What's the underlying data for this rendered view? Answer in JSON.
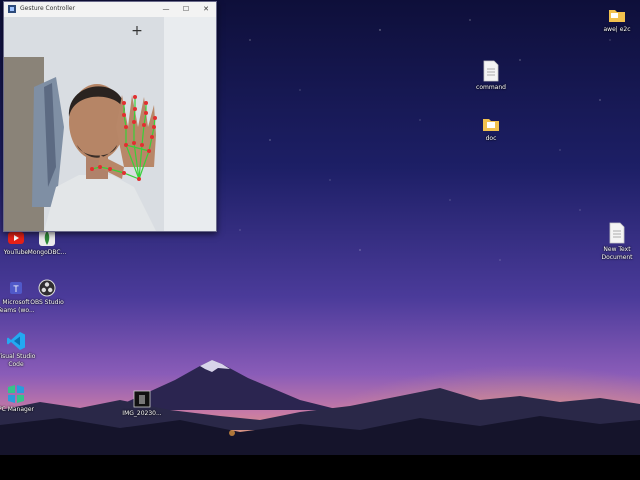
{
  "window": {
    "title": "Gesture Controller",
    "minimize_glyph": "—",
    "maximize_glyph": "☐",
    "close_glyph": "✕",
    "crosshair_glyph": "+"
  },
  "desktop_icons": {
    "awes_e2c": "awe| e2c",
    "command": "command",
    "doc": "doc",
    "new_text_document": "New Text\nDocument",
    "youtube": "YouTube",
    "mongodb": "MongoDBC...",
    "teams": "Microsoft\nTeams (wo...",
    "obs": "OBS Studio",
    "vscode": "Visual Studio\nCode",
    "pc_manager": "PC Manager",
    "img": "IMG_20230..."
  },
  "colors": {
    "folder": "#f2c14e",
    "hand_landmark": "#e03030",
    "hand_connection": "#38d038"
  },
  "icons": [
    "folder-icon",
    "text-file-icon",
    "youtube-icon",
    "mongodb-icon",
    "teams-icon",
    "obs-icon",
    "vscode-icon",
    "pc-manager-icon",
    "image-icon"
  ]
}
